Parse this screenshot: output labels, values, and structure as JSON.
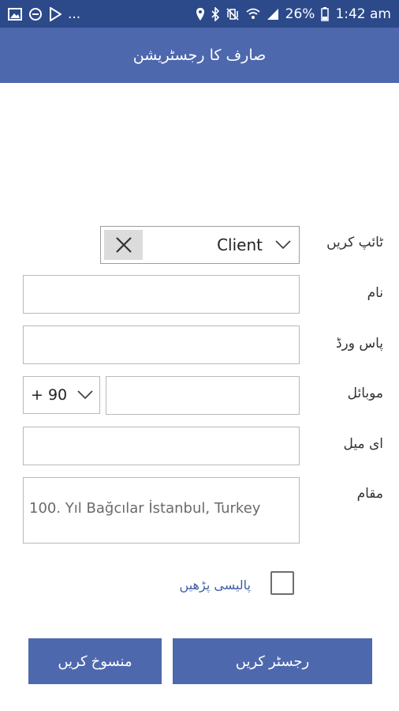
{
  "status_bar": {
    "left_icons": [
      "image-icon",
      "chat-bubble-icon",
      "play-store-icon"
    ],
    "overflow": "...",
    "right_icons": [
      "location-pin-icon",
      "bluetooth-icon",
      "vibrate-mute-icon",
      "wifi-icon",
      "signal-icon",
      "battery-icon"
    ],
    "battery": "26%",
    "time": "1:42 am"
  },
  "app_bar": {
    "title": "صارف کا رجسٹریشن"
  },
  "form": {
    "type": {
      "label": "ٹائپ کریں",
      "value": "Client"
    },
    "name": {
      "label": "نام",
      "value": ""
    },
    "password": {
      "label": "پاس ورڈ",
      "value": ""
    },
    "mobile": {
      "label": "موبائل",
      "country_code": "+ 90",
      "value": ""
    },
    "email": {
      "label": "ای میل",
      "value": ""
    },
    "location": {
      "label": "مقام",
      "value": "100. Yıl  Bağcılar İstanbul, Turkey"
    }
  },
  "policy": {
    "link_text": "پالیسی پڑھیں",
    "checked": false
  },
  "buttons": {
    "cancel": "منسوخ کریں",
    "register": "رجسٹر کریں"
  },
  "colors": {
    "status_bar": "#2c4a8a",
    "app_bar": "#4d68ad",
    "button": "#4d68ad",
    "link": "#3f5fa8"
  }
}
